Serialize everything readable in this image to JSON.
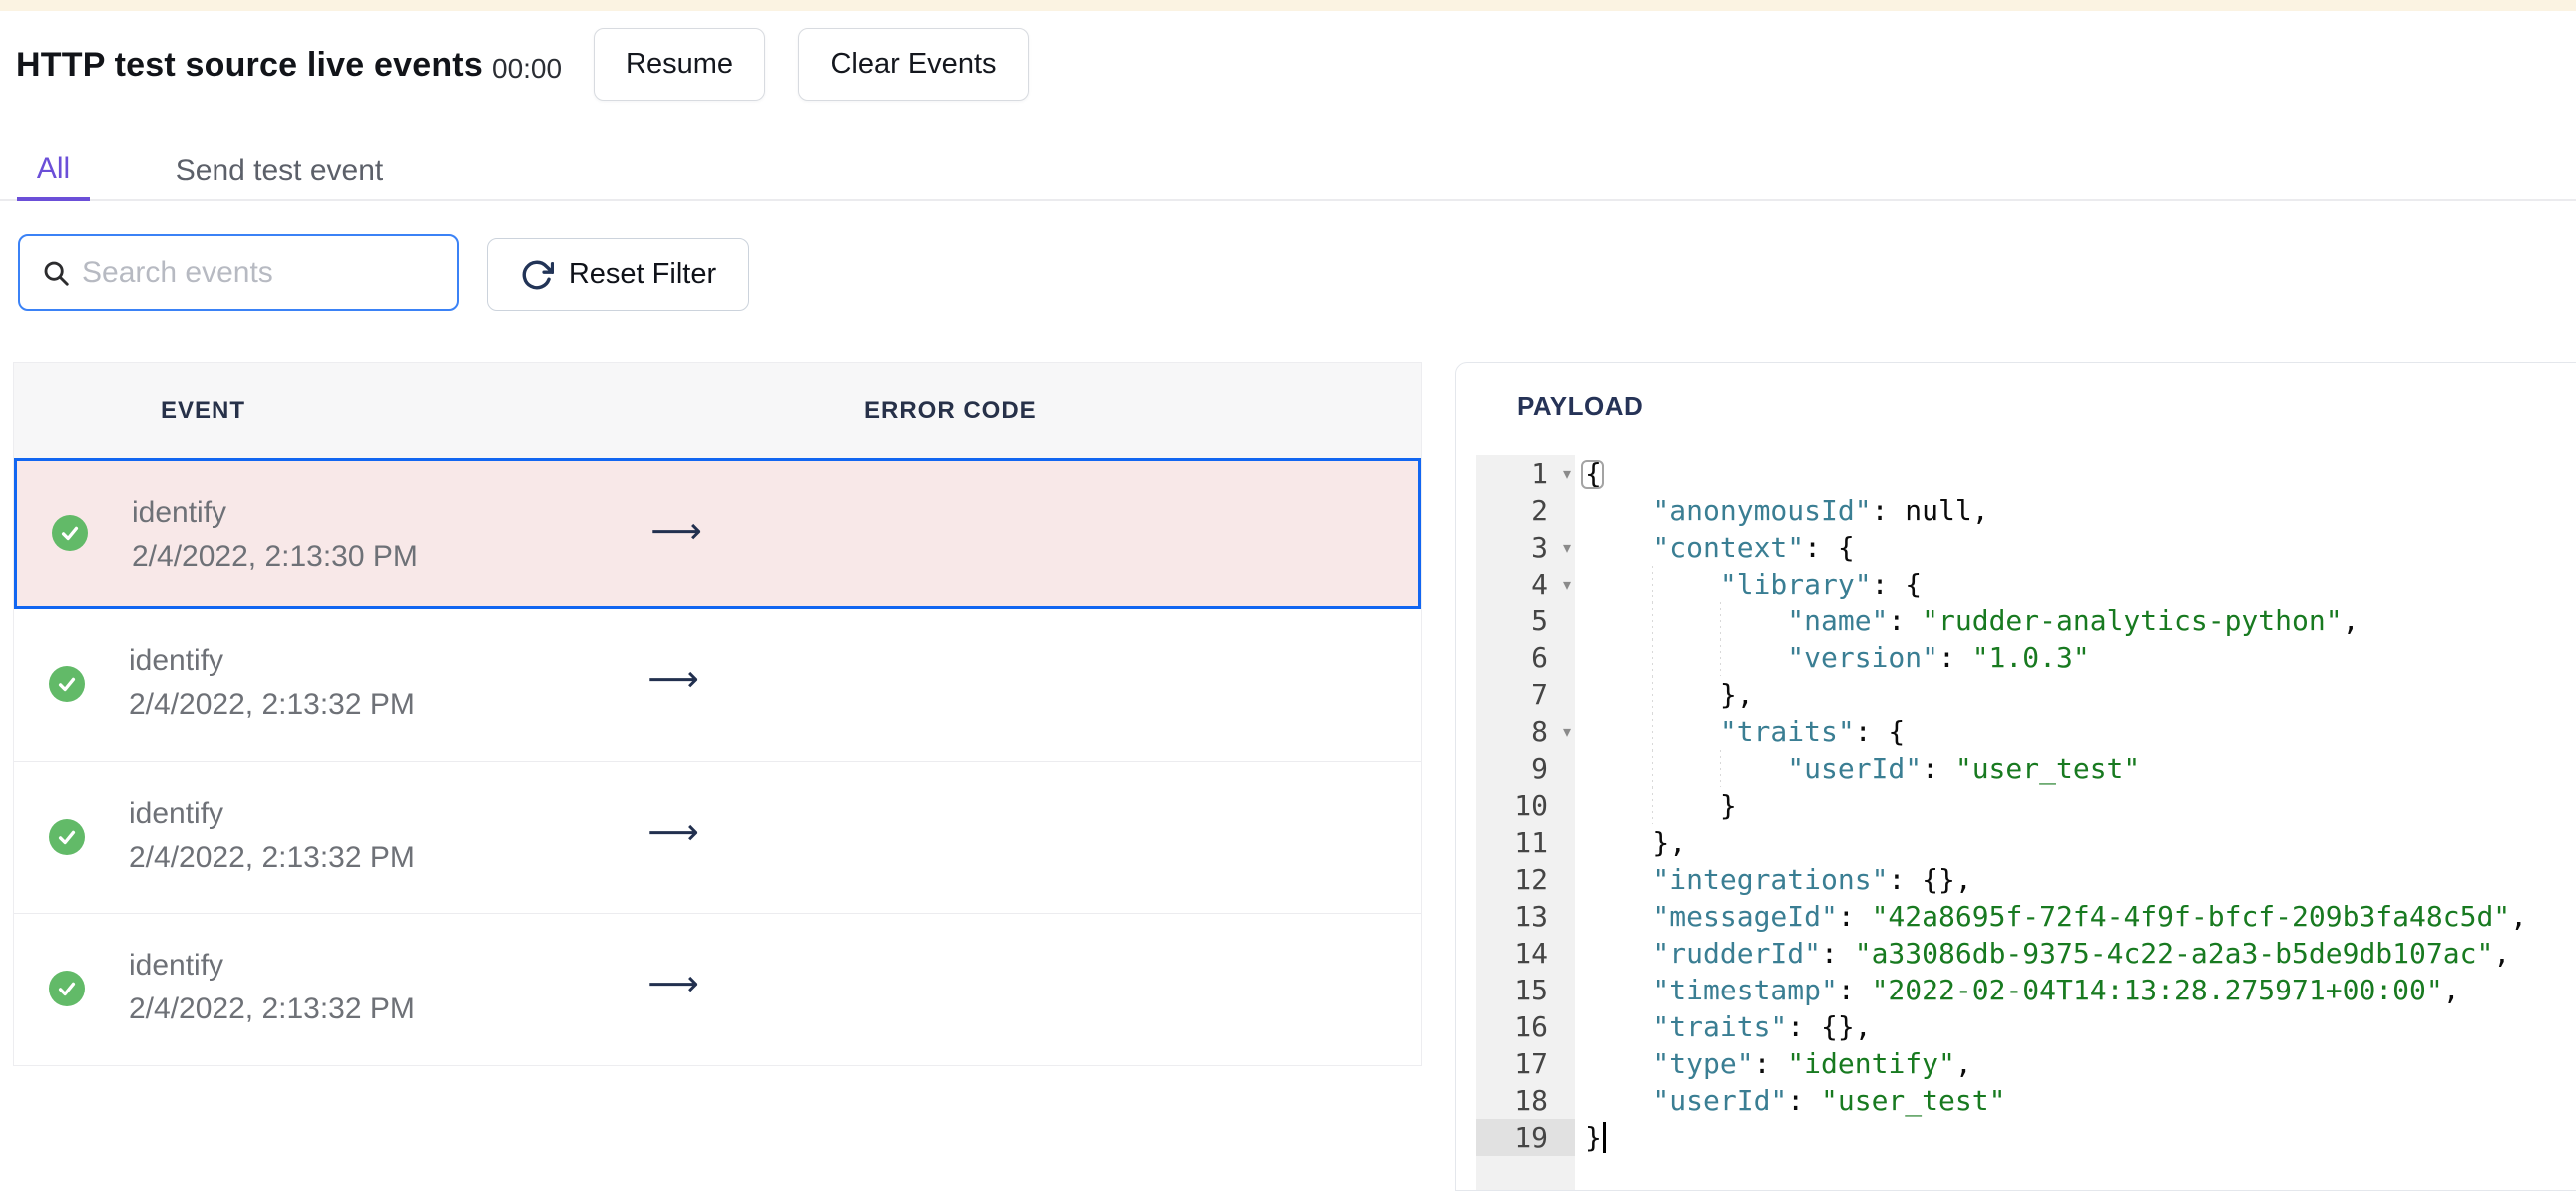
{
  "header": {
    "title": "HTTP test source live events",
    "timer": "00:00",
    "resume_label": "Resume",
    "clear_label": "Clear Events"
  },
  "tabs": [
    {
      "label": "All",
      "active": true
    },
    {
      "label": "Send test event",
      "active": false
    }
  ],
  "filters": {
    "search_placeholder": "Search events",
    "search_value": "",
    "reset_label": "Reset Filter"
  },
  "events_table": {
    "columns": [
      "EVENT",
      "ERROR CODE"
    ],
    "arrow_glyph": "⟶",
    "rows": [
      {
        "status": "success",
        "event": "identify",
        "timestamp": "2/4/2022, 2:13:30 PM",
        "error_code": "",
        "selected": true
      },
      {
        "status": "success",
        "event": "identify",
        "timestamp": "2/4/2022, 2:13:32 PM",
        "error_code": "",
        "selected": false
      },
      {
        "status": "success",
        "event": "identify",
        "timestamp": "2/4/2022, 2:13:32 PM",
        "error_code": "",
        "selected": false
      },
      {
        "status": "success",
        "event": "identify",
        "timestamp": "2/4/2022, 2:13:32 PM",
        "error_code": "",
        "selected": false
      }
    ]
  },
  "payload_panel": {
    "title": "PAYLOAD",
    "fold_glyph": "▾",
    "active_line": 19,
    "lines": [
      {
        "n": 1,
        "indent": 0,
        "fold": true,
        "match": true,
        "tokens": [
          [
            "p",
            "{"
          ]
        ]
      },
      {
        "n": 2,
        "indent": 4,
        "fold": false,
        "tokens": [
          [
            "k",
            "\"anonymousId\""
          ],
          [
            "p",
            ": "
          ],
          [
            "u",
            "null"
          ],
          [
            "p",
            ","
          ]
        ]
      },
      {
        "n": 3,
        "indent": 4,
        "fold": true,
        "tokens": [
          [
            "k",
            "\"context\""
          ],
          [
            "p",
            ": {"
          ]
        ]
      },
      {
        "n": 4,
        "indent": 8,
        "fold": true,
        "tokens": [
          [
            "k",
            "\"library\""
          ],
          [
            "p",
            ": {"
          ]
        ]
      },
      {
        "n": 5,
        "indent": 12,
        "fold": false,
        "tokens": [
          [
            "k",
            "\"name\""
          ],
          [
            "p",
            ": "
          ],
          [
            "s",
            "\"rudder-analytics-python\""
          ],
          [
            "p",
            ","
          ]
        ]
      },
      {
        "n": 6,
        "indent": 12,
        "fold": false,
        "tokens": [
          [
            "k",
            "\"version\""
          ],
          [
            "p",
            ": "
          ],
          [
            "s",
            "\"1.0.3\""
          ]
        ]
      },
      {
        "n": 7,
        "indent": 8,
        "fold": false,
        "tokens": [
          [
            "p",
            "},"
          ]
        ]
      },
      {
        "n": 8,
        "indent": 8,
        "fold": true,
        "tokens": [
          [
            "k",
            "\"traits\""
          ],
          [
            "p",
            ": {"
          ]
        ]
      },
      {
        "n": 9,
        "indent": 12,
        "fold": false,
        "tokens": [
          [
            "k",
            "\"userId\""
          ],
          [
            "p",
            ": "
          ],
          [
            "s",
            "\"user_test\""
          ]
        ]
      },
      {
        "n": 10,
        "indent": 8,
        "fold": false,
        "tokens": [
          [
            "p",
            "}"
          ]
        ]
      },
      {
        "n": 11,
        "indent": 4,
        "fold": false,
        "tokens": [
          [
            "p",
            "},"
          ]
        ]
      },
      {
        "n": 12,
        "indent": 4,
        "fold": false,
        "tokens": [
          [
            "k",
            "\"integrations\""
          ],
          [
            "p",
            ": {},"
          ]
        ]
      },
      {
        "n": 13,
        "indent": 4,
        "fold": false,
        "tokens": [
          [
            "k",
            "\"messageId\""
          ],
          [
            "p",
            ": "
          ],
          [
            "s",
            "\"42a8695f-72f4-4f9f-bfcf-209b3fa48c5d\""
          ],
          [
            "p",
            ","
          ]
        ]
      },
      {
        "n": 14,
        "indent": 4,
        "fold": false,
        "tokens": [
          [
            "k",
            "\"rudderId\""
          ],
          [
            "p",
            ": "
          ],
          [
            "s",
            "\"a33086db-9375-4c22-a2a3-b5de9db107ac\""
          ],
          [
            "p",
            ","
          ]
        ]
      },
      {
        "n": 15,
        "indent": 4,
        "fold": false,
        "tokens": [
          [
            "k",
            "\"timestamp\""
          ],
          [
            "p",
            ": "
          ],
          [
            "s",
            "\"2022-02-04T14:13:28.275971+00:00\""
          ],
          [
            "p",
            ","
          ]
        ]
      },
      {
        "n": 16,
        "indent": 4,
        "fold": false,
        "tokens": [
          [
            "k",
            "\"traits\""
          ],
          [
            "p",
            ": {},"
          ]
        ]
      },
      {
        "n": 17,
        "indent": 4,
        "fold": false,
        "tokens": [
          [
            "k",
            "\"type\""
          ],
          [
            "p",
            ": "
          ],
          [
            "s",
            "\"identify\""
          ],
          [
            "p",
            ","
          ]
        ]
      },
      {
        "n": 18,
        "indent": 4,
        "fold": false,
        "tokens": [
          [
            "k",
            "\"userId\""
          ],
          [
            "p",
            ": "
          ],
          [
            "s",
            "\"user_test\""
          ]
        ]
      },
      {
        "n": 19,
        "indent": 0,
        "fold": false,
        "active": true,
        "tokens": [
          [
            "p",
            "}"
          ]
        ]
      }
    ]
  },
  "colors": {
    "cream_topbar": "#fbf3e2",
    "accent_purple": "#6b4fd8",
    "focus_blue": "#3b82f6",
    "selected_border_blue": "#1266f1",
    "selected_row_pink": "#f8e8e8",
    "success_green": "#62ba68",
    "json_key_teal": "#3a7e93",
    "json_string_green": "#187a20",
    "navy_text": "#263357"
  }
}
